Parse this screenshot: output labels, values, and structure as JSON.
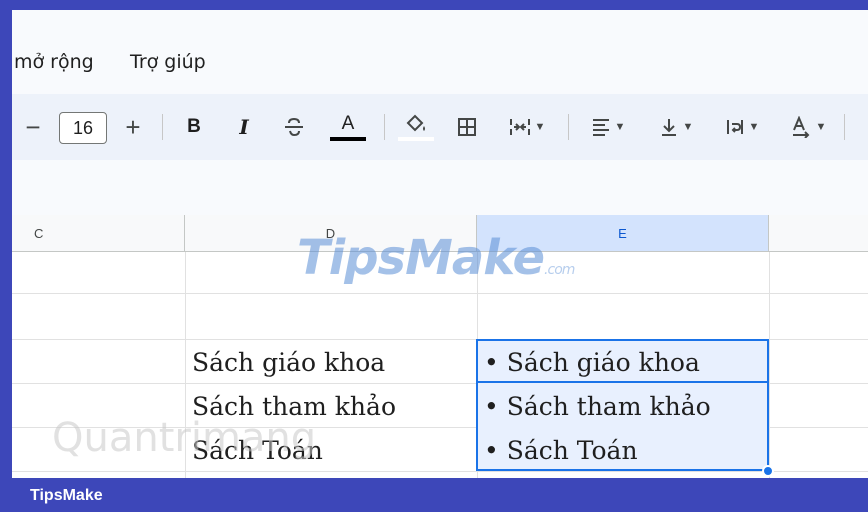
{
  "menu": {
    "extensions": "mở rộng",
    "help": "Trợ giúp"
  },
  "toolbar": {
    "font_size": "16",
    "decrease_symbol": "−",
    "increase_symbol": "+",
    "bold_label": "B",
    "italic_label": "I",
    "text_color_label": "A"
  },
  "grid": {
    "columns": [
      "C",
      "D",
      "E"
    ],
    "selected_column": "E",
    "column_d": [
      "Sách giáo khoa",
      "Sách tham khảo",
      "Sách Toán"
    ],
    "column_e": [
      "• Sách giáo khoa",
      "• Sách tham khảo",
      "• Sách Toán"
    ]
  },
  "watermark": {
    "logo": "TipsMake",
    "logo_suffix": ".com",
    "quantrimang": "Quantrimang"
  },
  "footer": {
    "brand": "TipsMake"
  },
  "colors": {
    "frame_blue": "#3d47b9",
    "selection_blue": "#1a73e8",
    "selection_fill": "#e8f0fe",
    "header_selected": "#d3e3fd"
  }
}
